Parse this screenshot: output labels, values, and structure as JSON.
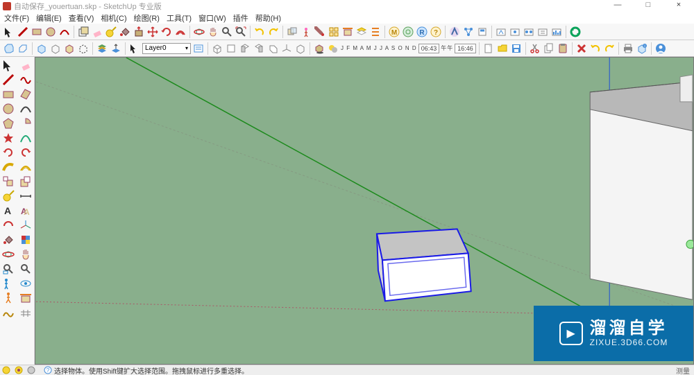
{
  "window": {
    "title": "自动保存_youertuan.skp - SketchUp 专业版",
    "min": "—",
    "max": "□",
    "close": "×"
  },
  "menu": {
    "file": "文件(F)",
    "edit": "编辑(E)",
    "view": "查看(V)",
    "camera": "相机(C)",
    "draw": "绘图(R)",
    "tools": "工具(T)",
    "window": "窗口(W)",
    "plugins": "插件",
    "help": "帮助(H)"
  },
  "layer": {
    "label": "Layer0"
  },
  "shadows": {
    "months": "J F M A M J J A S O N D",
    "date": "06:43",
    "ampm": "午午",
    "time": "16:46"
  },
  "status": {
    "hint": "选择物体。使用Shift键扩大选择范围。拖拽鼠标进行多重选择。",
    "measure": "测量"
  },
  "watermark": {
    "cn": "溜溜自学",
    "en": "ZIXUE.3D66.COM"
  }
}
